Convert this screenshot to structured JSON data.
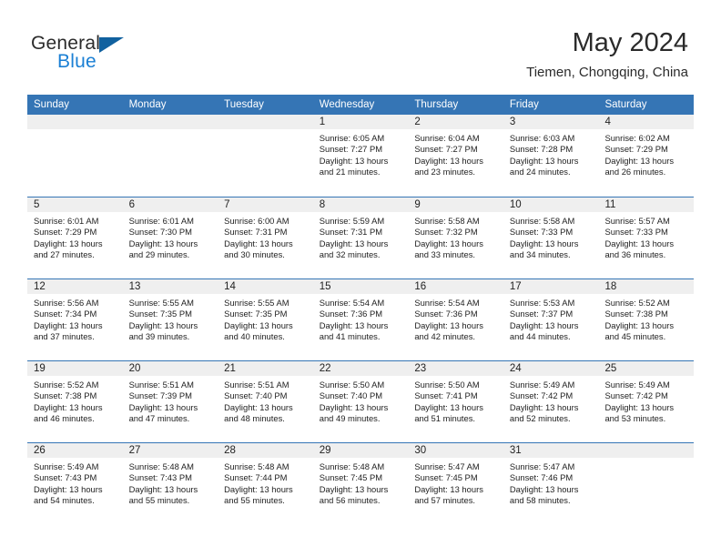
{
  "logo": {
    "word_general": "General",
    "word_blue": "Blue",
    "triangle_color": "#11619f",
    "blue_color": "#1a7fd4"
  },
  "header": {
    "month_title": "May 2024",
    "location": "Tiemen, Chongqing, China",
    "accent_color": "#3575b5",
    "day_band_color": "#efefef"
  },
  "weekdays": [
    "Sunday",
    "Monday",
    "Tuesday",
    "Wednesday",
    "Thursday",
    "Friday",
    "Saturday"
  ],
  "weeks": [
    [
      {
        "day": "",
        "sunrise": "",
        "sunset": "",
        "daylight": ""
      },
      {
        "day": "",
        "sunrise": "",
        "sunset": "",
        "daylight": ""
      },
      {
        "day": "",
        "sunrise": "",
        "sunset": "",
        "daylight": ""
      },
      {
        "day": "1",
        "sunrise": "Sunrise: 6:05 AM",
        "sunset": "Sunset: 7:27 PM",
        "daylight": "Daylight: 13 hours and 21 minutes."
      },
      {
        "day": "2",
        "sunrise": "Sunrise: 6:04 AM",
        "sunset": "Sunset: 7:27 PM",
        "daylight": "Daylight: 13 hours and 23 minutes."
      },
      {
        "day": "3",
        "sunrise": "Sunrise: 6:03 AM",
        "sunset": "Sunset: 7:28 PM",
        "daylight": "Daylight: 13 hours and 24 minutes."
      },
      {
        "day": "4",
        "sunrise": "Sunrise: 6:02 AM",
        "sunset": "Sunset: 7:29 PM",
        "daylight": "Daylight: 13 hours and 26 minutes."
      }
    ],
    [
      {
        "day": "5",
        "sunrise": "Sunrise: 6:01 AM",
        "sunset": "Sunset: 7:29 PM",
        "daylight": "Daylight: 13 hours and 27 minutes."
      },
      {
        "day": "6",
        "sunrise": "Sunrise: 6:01 AM",
        "sunset": "Sunset: 7:30 PM",
        "daylight": "Daylight: 13 hours and 29 minutes."
      },
      {
        "day": "7",
        "sunrise": "Sunrise: 6:00 AM",
        "sunset": "Sunset: 7:31 PM",
        "daylight": "Daylight: 13 hours and 30 minutes."
      },
      {
        "day": "8",
        "sunrise": "Sunrise: 5:59 AM",
        "sunset": "Sunset: 7:31 PM",
        "daylight": "Daylight: 13 hours and 32 minutes."
      },
      {
        "day": "9",
        "sunrise": "Sunrise: 5:58 AM",
        "sunset": "Sunset: 7:32 PM",
        "daylight": "Daylight: 13 hours and 33 minutes."
      },
      {
        "day": "10",
        "sunrise": "Sunrise: 5:58 AM",
        "sunset": "Sunset: 7:33 PM",
        "daylight": "Daylight: 13 hours and 34 minutes."
      },
      {
        "day": "11",
        "sunrise": "Sunrise: 5:57 AM",
        "sunset": "Sunset: 7:33 PM",
        "daylight": "Daylight: 13 hours and 36 minutes."
      }
    ],
    [
      {
        "day": "12",
        "sunrise": "Sunrise: 5:56 AM",
        "sunset": "Sunset: 7:34 PM",
        "daylight": "Daylight: 13 hours and 37 minutes."
      },
      {
        "day": "13",
        "sunrise": "Sunrise: 5:55 AM",
        "sunset": "Sunset: 7:35 PM",
        "daylight": "Daylight: 13 hours and 39 minutes."
      },
      {
        "day": "14",
        "sunrise": "Sunrise: 5:55 AM",
        "sunset": "Sunset: 7:35 PM",
        "daylight": "Daylight: 13 hours and 40 minutes."
      },
      {
        "day": "15",
        "sunrise": "Sunrise: 5:54 AM",
        "sunset": "Sunset: 7:36 PM",
        "daylight": "Daylight: 13 hours and 41 minutes."
      },
      {
        "day": "16",
        "sunrise": "Sunrise: 5:54 AM",
        "sunset": "Sunset: 7:36 PM",
        "daylight": "Daylight: 13 hours and 42 minutes."
      },
      {
        "day": "17",
        "sunrise": "Sunrise: 5:53 AM",
        "sunset": "Sunset: 7:37 PM",
        "daylight": "Daylight: 13 hours and 44 minutes."
      },
      {
        "day": "18",
        "sunrise": "Sunrise: 5:52 AM",
        "sunset": "Sunset: 7:38 PM",
        "daylight": "Daylight: 13 hours and 45 minutes."
      }
    ],
    [
      {
        "day": "19",
        "sunrise": "Sunrise: 5:52 AM",
        "sunset": "Sunset: 7:38 PM",
        "daylight": "Daylight: 13 hours and 46 minutes."
      },
      {
        "day": "20",
        "sunrise": "Sunrise: 5:51 AM",
        "sunset": "Sunset: 7:39 PM",
        "daylight": "Daylight: 13 hours and 47 minutes."
      },
      {
        "day": "21",
        "sunrise": "Sunrise: 5:51 AM",
        "sunset": "Sunset: 7:40 PM",
        "daylight": "Daylight: 13 hours and 48 minutes."
      },
      {
        "day": "22",
        "sunrise": "Sunrise: 5:50 AM",
        "sunset": "Sunset: 7:40 PM",
        "daylight": "Daylight: 13 hours and 49 minutes."
      },
      {
        "day": "23",
        "sunrise": "Sunrise: 5:50 AM",
        "sunset": "Sunset: 7:41 PM",
        "daylight": "Daylight: 13 hours and 51 minutes."
      },
      {
        "day": "24",
        "sunrise": "Sunrise: 5:49 AM",
        "sunset": "Sunset: 7:42 PM",
        "daylight": "Daylight: 13 hours and 52 minutes."
      },
      {
        "day": "25",
        "sunrise": "Sunrise: 5:49 AM",
        "sunset": "Sunset: 7:42 PM",
        "daylight": "Daylight: 13 hours and 53 minutes."
      }
    ],
    [
      {
        "day": "26",
        "sunrise": "Sunrise: 5:49 AM",
        "sunset": "Sunset: 7:43 PM",
        "daylight": "Daylight: 13 hours and 54 minutes."
      },
      {
        "day": "27",
        "sunrise": "Sunrise: 5:48 AM",
        "sunset": "Sunset: 7:43 PM",
        "daylight": "Daylight: 13 hours and 55 minutes."
      },
      {
        "day": "28",
        "sunrise": "Sunrise: 5:48 AM",
        "sunset": "Sunset: 7:44 PM",
        "daylight": "Daylight: 13 hours and 55 minutes."
      },
      {
        "day": "29",
        "sunrise": "Sunrise: 5:48 AM",
        "sunset": "Sunset: 7:45 PM",
        "daylight": "Daylight: 13 hours and 56 minutes."
      },
      {
        "day": "30",
        "sunrise": "Sunrise: 5:47 AM",
        "sunset": "Sunset: 7:45 PM",
        "daylight": "Daylight: 13 hours and 57 minutes."
      },
      {
        "day": "31",
        "sunrise": "Sunrise: 5:47 AM",
        "sunset": "Sunset: 7:46 PM",
        "daylight": "Daylight: 13 hours and 58 minutes."
      },
      {
        "day": "",
        "sunrise": "",
        "sunset": "",
        "daylight": ""
      }
    ]
  ]
}
